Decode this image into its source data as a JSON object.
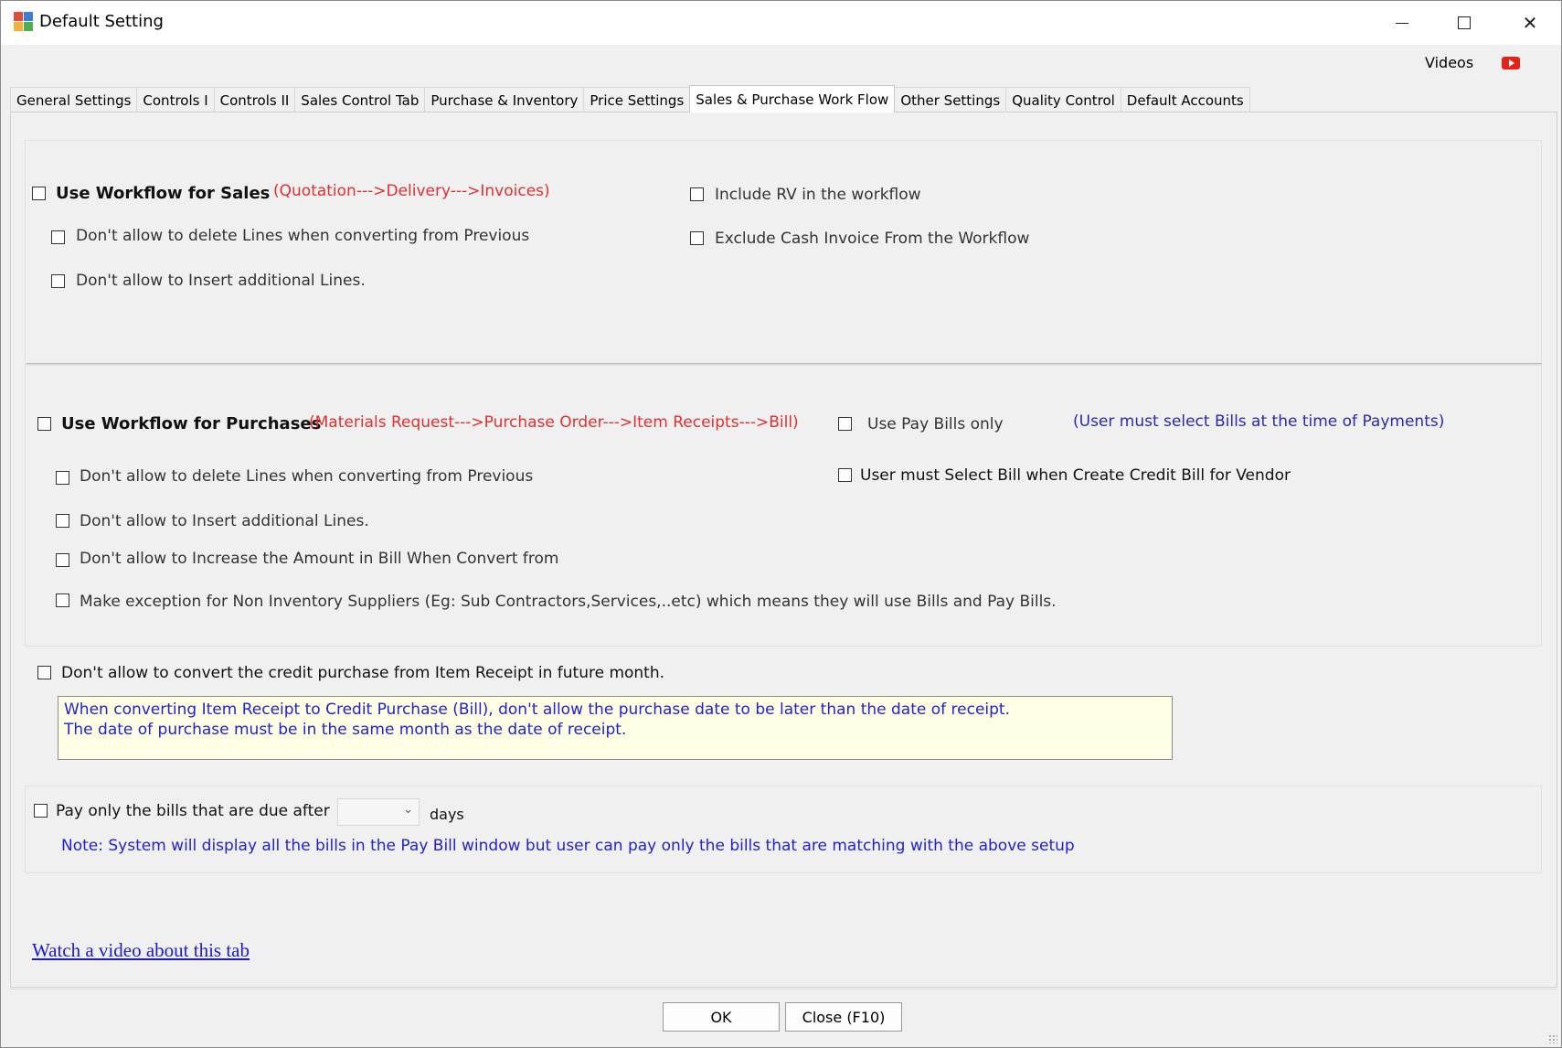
{
  "window": {
    "title": "Default Setting",
    "minimize_icon": "minimize-icon",
    "maximize_icon": "maximize-icon",
    "close_icon": "close-icon"
  },
  "header": {
    "videos_label": "Videos",
    "video_icon": "youtube-icon"
  },
  "tabs": [
    {
      "label": "General Settings"
    },
    {
      "label": "Controls I"
    },
    {
      "label": "Controls II"
    },
    {
      "label": "Sales Control Tab"
    },
    {
      "label": "Purchase & Inventory"
    },
    {
      "label": "Price Settings"
    },
    {
      "label": "Sales & Purchase Work Flow",
      "active": true
    },
    {
      "label": "Other Settings"
    },
    {
      "label": "Quality Control"
    },
    {
      "label": "Default Accounts"
    }
  ],
  "sales": {
    "use_workflow": {
      "label": "Use Workflow for Sales",
      "checked": false
    },
    "workflow_note": "(Quotation--->Delivery--->Invoices)",
    "no_delete_lines": {
      "label": "Don't allow to delete Lines when converting from Previous",
      "checked": false
    },
    "no_insert_lines": {
      "label": "Don't allow to Insert additional Lines.",
      "checked": false
    },
    "include_rv": {
      "label": "Include RV in the workflow",
      "checked": false
    },
    "exclude_cash": {
      "label": "Exclude Cash Invoice From the Workflow",
      "checked": false
    }
  },
  "purchases": {
    "use_workflow": {
      "label": "Use Workflow for Purchases",
      "checked": false
    },
    "workflow_note": "(Materials Request--->Purchase Order--->Item Receipts--->Bill)",
    "use_pay_bills_only": {
      "label": "Use Pay Bills only",
      "checked": false
    },
    "pay_bills_note": "(User must select Bills at the time of Payments)",
    "no_delete_lines": {
      "label": "Don't allow to delete Lines when converting from Previous",
      "checked": false
    },
    "select_bill_credit": {
      "label": "User must Select Bill when Create Credit Bill for Vendor",
      "checked": false
    },
    "no_insert_lines": {
      "label": "Don't allow to Insert additional Lines.",
      "checked": false
    },
    "no_increase_amount": {
      "label": "Don't allow to Increase the Amount in Bill When Convert from",
      "checked": false
    },
    "non_inventory_exception": {
      "label": "Make exception for Non Inventory Suppliers (Eg: Sub Contractors,Services,..etc) which means they will use Bills and Pay Bills.",
      "checked": false
    }
  },
  "credit_purchase": {
    "label": "Don't allow to convert the credit purchase from Item Receipt in future month.",
    "checked": false,
    "note_line1": "When converting Item Receipt to Credit Purchase (Bill), don't allow the purchase date to be later than the date of receipt.",
    "note_line2": "The date of purchase must be in the same month as the date of receipt."
  },
  "pay_bills_due": {
    "label": "Pay only the bills that are due after",
    "checked": false,
    "days_value": "",
    "days_label": "days",
    "note": "Note: System will display all the bills in the Pay Bill window but user can pay only the bills that are matching with the above setup"
  },
  "video_link": "Watch a video about this tab",
  "footer": {
    "ok_label": "OK",
    "close_label": "Close (F10)"
  },
  "colors": {
    "red_note": "#e03030",
    "blue_note": "#2a2aa8",
    "note_box_bg": "#ffffe6",
    "link": "#1a1ad0"
  }
}
